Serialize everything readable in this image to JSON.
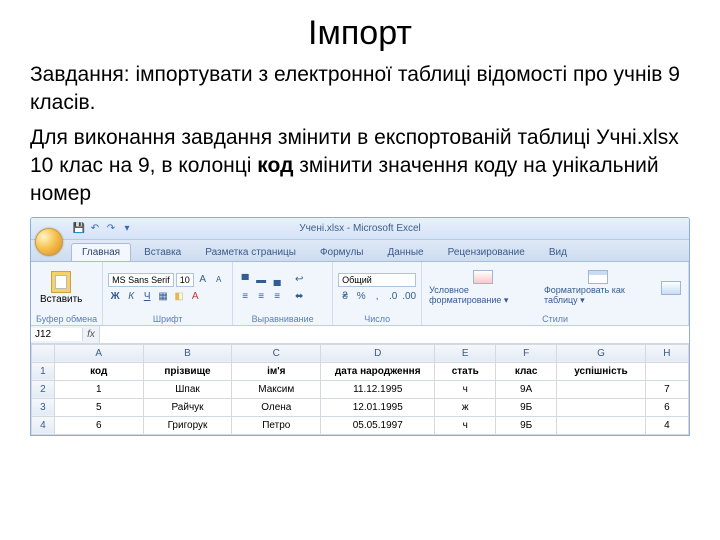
{
  "heading": "Імпорт",
  "para1": "Завдання: імпортувати з електронної таблиці відомості про учнів 9 класів.",
  "para2_a": "Для виконання завдання змінити в експортованій таблиці Учні.xlsx 10 клас на 9, в колонці ",
  "para2_b": "код",
  "para2_c": " змінити значення коду на унікальний номер",
  "excel": {
    "title": "Учені.xlsx - Microsoft Excel",
    "tabs": [
      "Главная",
      "Вставка",
      "Разметка страницы",
      "Формулы",
      "Данные",
      "Рецензирование",
      "Вид"
    ],
    "groups": {
      "clipboard": "Буфер обмена",
      "clipboard_paste": "Вставить",
      "font": "Шрифт",
      "font_name": "MS Sans Serif",
      "font_size": "10",
      "alignment": "Выравнивание",
      "number": "Число",
      "number_format": "Общий",
      "styles": "Стили",
      "cond_fmt": "Условное форматирование ▾",
      "table_fmt": "Форматировать как таблицу ▾"
    },
    "namebox": "J12",
    "columns": [
      "A",
      "B",
      "C",
      "D",
      "E",
      "F",
      "G",
      "H"
    ],
    "headers": [
      "код",
      "прізвище",
      "ім'я",
      "дата народження",
      "стать",
      "клас",
      "успішність",
      ""
    ],
    "rows": [
      [
        "1",
        "Шпак",
        "Максим",
        "11.12.1995",
        "ч",
        "9А",
        "",
        "7"
      ],
      [
        "5",
        "Райчук",
        "Олена",
        "12.01.1995",
        "ж",
        "9Б",
        "",
        "6"
      ],
      [
        "6",
        "Григорук",
        "Петро",
        "05.05.1997",
        "ч",
        "9Б",
        "",
        "4"
      ]
    ],
    "rownums": [
      "1",
      "2",
      "3",
      "4"
    ]
  }
}
